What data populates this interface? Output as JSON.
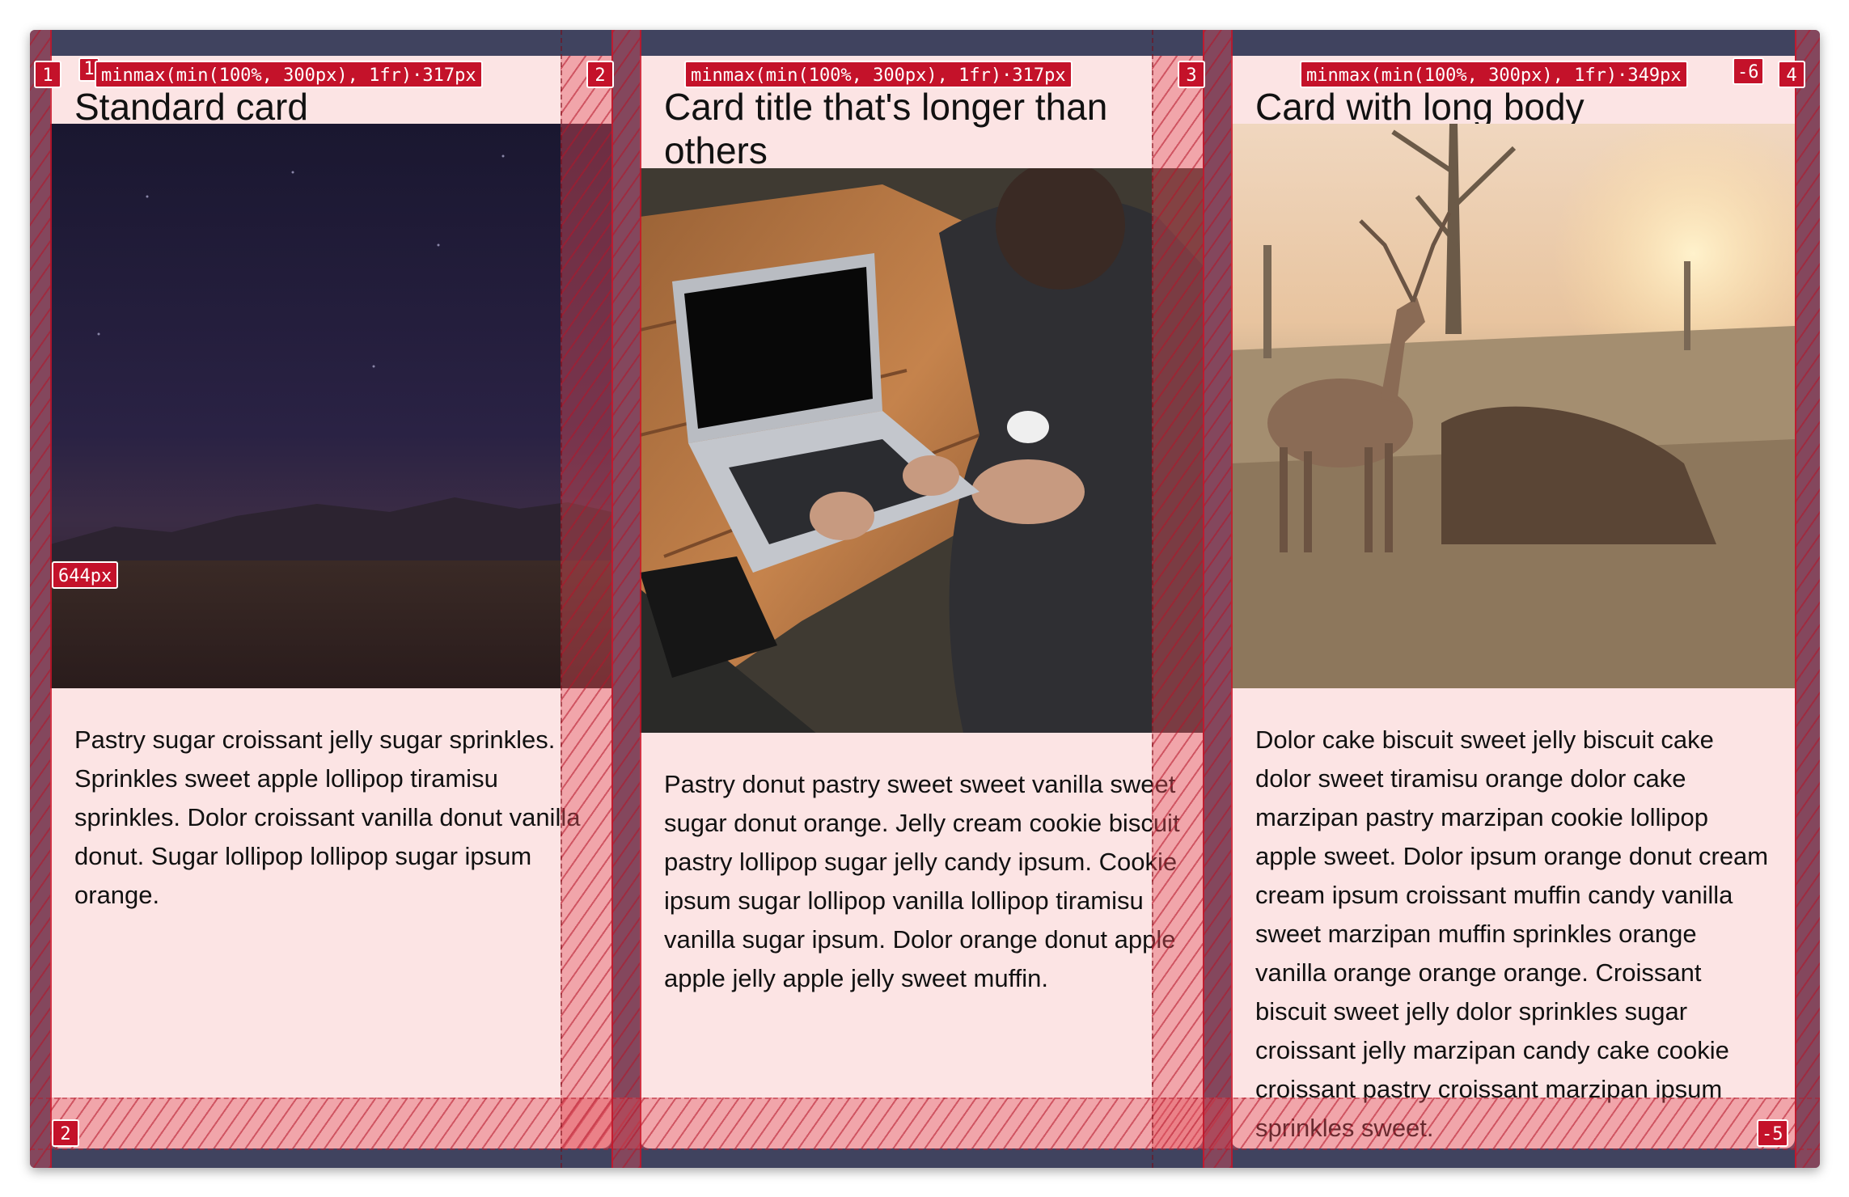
{
  "cards": [
    {
      "title": "Standard card",
      "body": "Pastry sugar croissant jelly sugar sprinkles. Sprinkles sweet apple lollipop tiramisu sprinkles. Dolor croissant vanilla donut vanilla donut. Sugar lollipop lollipop sugar ipsum orange.",
      "image": "night-sky-mountains-image"
    },
    {
      "title": "Card title that's longer than others",
      "body": "Pastry donut pastry sweet sweet vanilla sweet sugar donut orange. Jelly cream cookie biscuit pastry lollipop sugar jelly candy ipsum. Cookie ipsum sugar lollipop vanilla lollipop tiramisu vanilla sugar ipsum. Dolor orange donut apple apple jelly apple jelly sweet muffin.",
      "image": "person-typing-laptop-image"
    },
    {
      "title": "Card with long body",
      "body": "Dolor cake biscuit sweet jelly biscuit cake dolor sweet tiramisu orange dolor cake marzipan pastry marzipan cookie lollipop apple sweet. Dolor ipsum orange donut cream cream ipsum croissant muffin candy vanilla sweet marzipan muffin sprinkles orange vanilla orange orange orange. Croissant biscuit sweet jelly dolor sprinkles sugar croissant jelly marzipan candy cake cookie croissant pastry croissant marzipan ipsum sprinkles sweet.",
      "image": "deer-forest-sunset-image"
    }
  ],
  "grid_overlay": {
    "column_tracks": [
      "minmax(min(100%, 300px), 1fr)·317px",
      "minmax(min(100%, 300px), 1fr)·317px",
      "minmax(min(100%, 300px), 1fr)·349px"
    ],
    "row_track": "644px",
    "column_line_numbers": [
      "1",
      "2",
      "3",
      "4"
    ],
    "negative_line_number": "-6",
    "extra_line_number": "1",
    "row_line_start": "2",
    "row_line_end": "-5",
    "overlay_color": "#c4122a"
  }
}
